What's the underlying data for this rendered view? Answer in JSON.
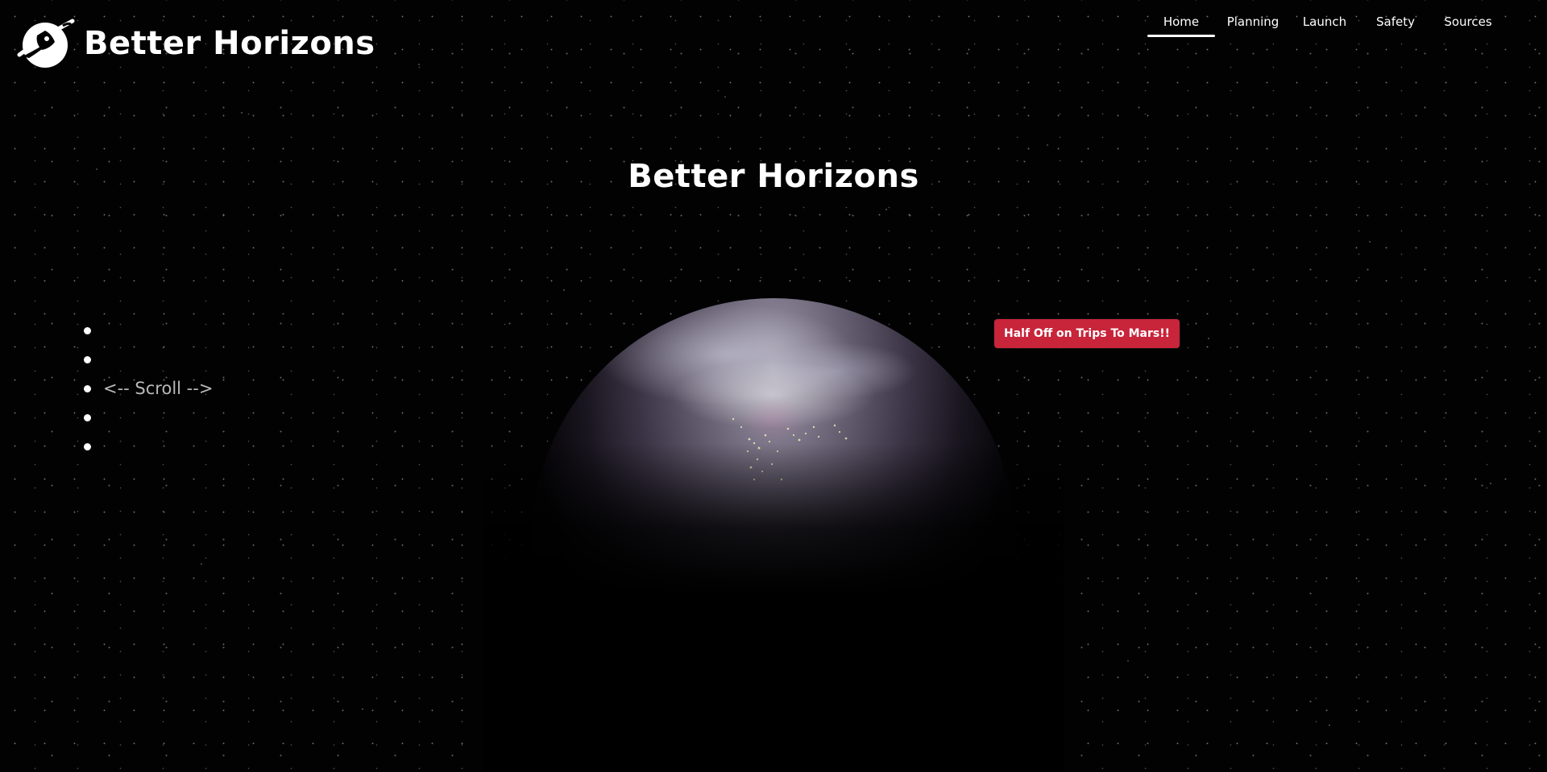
{
  "brand": {
    "name": "Better Horizons",
    "logo_icon": "planet-rocket-logo-icon"
  },
  "nav": {
    "items": [
      {
        "label": "Home",
        "active": true
      },
      {
        "label": "Planning",
        "active": false
      },
      {
        "label": "Launch",
        "active": false
      },
      {
        "label": "Safety",
        "active": false
      },
      {
        "label": "Sources",
        "active": false
      }
    ]
  },
  "hero": {
    "title": "Better Horizons"
  },
  "scroll_list": {
    "items": [
      "",
      "",
      "<-- Scroll -->",
      "",
      ""
    ]
  },
  "promo": {
    "label": "Half Off on Trips To Mars!!",
    "color": "#c8243a"
  },
  "colors": {
    "background": "#000000",
    "text": "#ffffff",
    "muted_text": "#b9b9b9",
    "accent": "#c8243a"
  }
}
